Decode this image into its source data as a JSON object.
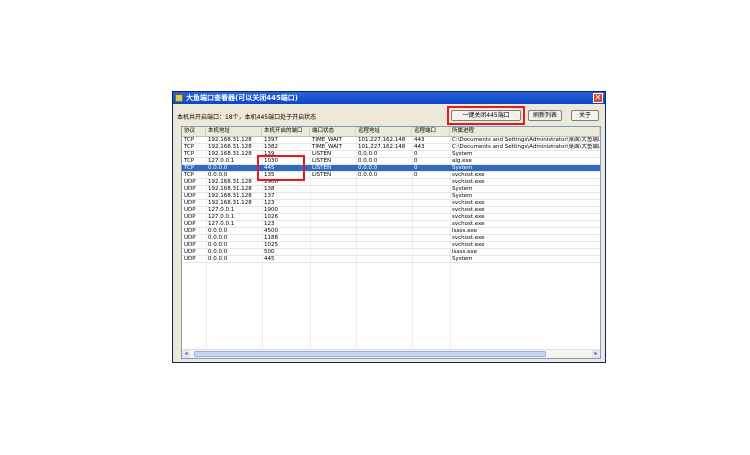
{
  "window": {
    "title": "大鱼端口查看器(可以关闭445端口)",
    "close_glyph": "✕"
  },
  "status_text": "本机共开启端口：18个，本机445端口处于开启状态",
  "buttons": {
    "close_445": "一键关闭445端口",
    "refresh": "刷新列表",
    "about": "关于"
  },
  "table": {
    "columns": [
      "协议",
      "本机地址",
      "本机开启的端口",
      "端口状态",
      "远程地址",
      "远程端口",
      "所属进程"
    ],
    "selected_row": 4,
    "rows": [
      [
        "TCP",
        "192.168.31.128",
        "1397",
        "TIME_WAIT",
        "101.227.162.148",
        "443",
        "C:\\Documents and Settings\\Administrator\\桌面\\大鱼端口查"
      ],
      [
        "TCP",
        "192.168.31.128",
        "1382",
        "TIME_WAIT",
        "101.227.162.148",
        "443",
        "C:\\Documents and Settings\\Administrator\\桌面\\大鱼端口查"
      ],
      [
        "TCP",
        "192.168.31.128",
        "139",
        "LISTEN",
        "0.0.0.0",
        "0",
        "System"
      ],
      [
        "TCP",
        "127.0.0.1",
        "1030",
        "LISTEN",
        "0.0.0.0",
        "0",
        "alg.exe"
      ],
      [
        "TCP",
        "0.0.0.0",
        "445",
        "LISTEN",
        "0.0.0.0",
        "0",
        "System"
      ],
      [
        "TCP",
        "0.0.0.0",
        "135",
        "LISTEN",
        "0.0.0.0",
        "0",
        "svchost.exe"
      ],
      [
        "UDP",
        "192.168.31.128",
        "1900",
        "",
        "",
        "",
        "svchost.exe"
      ],
      [
        "UDP",
        "192.168.31.128",
        "138",
        "",
        "",
        "",
        "System"
      ],
      [
        "UDP",
        "192.168.31.128",
        "137",
        "",
        "",
        "",
        "System"
      ],
      [
        "UDP",
        "192.168.31.128",
        "123",
        "",
        "",
        "",
        "svchost.exe"
      ],
      [
        "UDP",
        "127.0.0.1",
        "1900",
        "",
        "",
        "",
        "svchost.exe"
      ],
      [
        "UDP",
        "127.0.0.1",
        "1026",
        "",
        "",
        "",
        "svchost.exe"
      ],
      [
        "UDP",
        "127.0.0.1",
        "123",
        "",
        "",
        "",
        "svchost.exe"
      ],
      [
        "UDP",
        "0.0.0.0",
        "4500",
        "",
        "",
        "",
        "lsass.exe"
      ],
      [
        "UDP",
        "0.0.0.0",
        "1188",
        "",
        "",
        "",
        "svchost.exe"
      ],
      [
        "UDP",
        "0.0.0.0",
        "1025",
        "",
        "",
        "",
        "svchost.exe"
      ],
      [
        "UDP",
        "0.0.0.0",
        "500",
        "",
        "",
        "",
        "lsass.exe"
      ],
      [
        "UDP",
        "0.0.0.0",
        "445",
        "",
        "",
        "",
        "System"
      ]
    ]
  },
  "colors": {
    "highlight_box": "#e21b23",
    "selection": "#316ac5",
    "titlebar": "#0a46c8"
  }
}
